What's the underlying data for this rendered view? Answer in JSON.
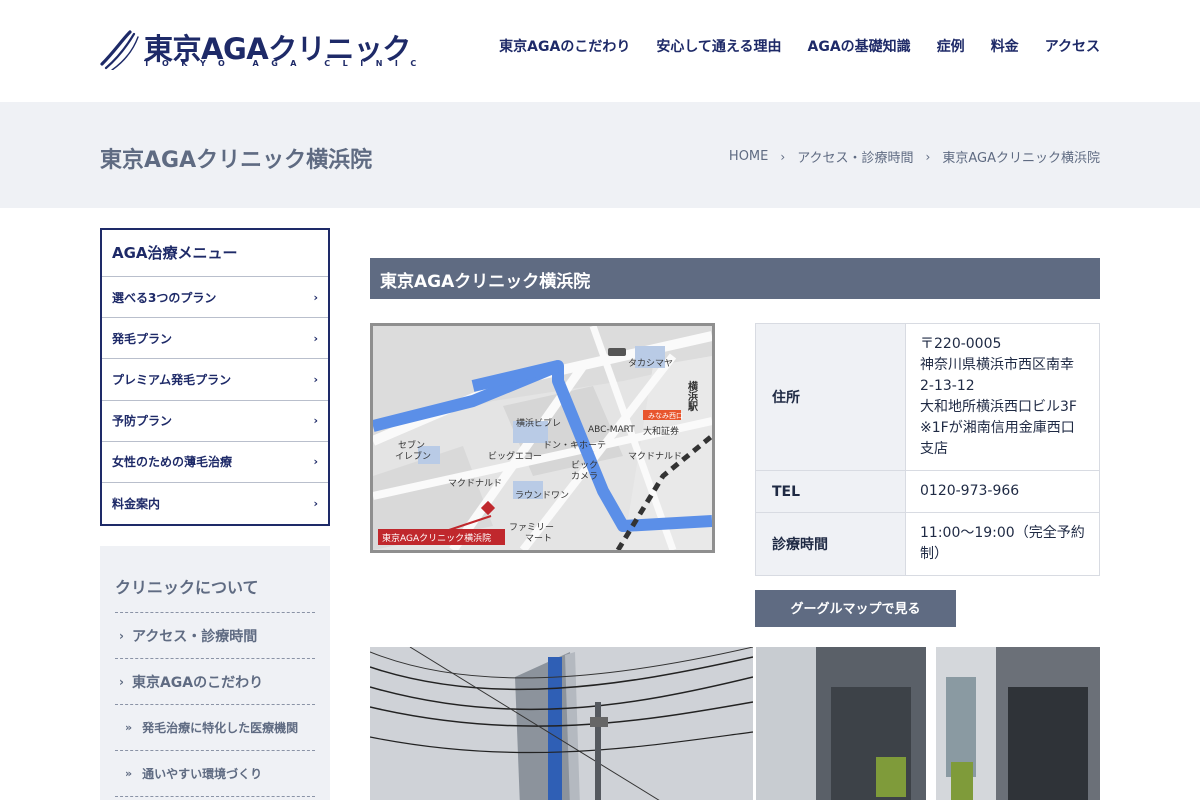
{
  "header": {
    "logo_text": "東京AGAクリニック",
    "logo_sub": "TOKYO AGA CLINIC",
    "nav": [
      "東京AGAのこだわり",
      "安心して通える理由",
      "AGAの基礎知識",
      "症例",
      "料金",
      "アクセス"
    ]
  },
  "title_band": {
    "page_title": "東京AGAクリニック横浜院",
    "breadcrumb": [
      "HOME",
      "アクセス・診療時間",
      "東京AGAクリニック横浜院"
    ]
  },
  "sidebar": {
    "menu_title": "AGA治療メニュー",
    "menu_items": [
      "選べる3つのプラン",
      "発毛プラン",
      "プレミアム発毛プラン",
      "予防プラン",
      "女性のための薄毛治療",
      "料金案内"
    ],
    "about_title": "クリニックについて",
    "about_items": [
      "アクセス・診療時間",
      "東京AGAのこだわり"
    ],
    "about_sub_items": [
      "発毛治療に特化した医療機関",
      "通いやすい環境づくり"
    ]
  },
  "main": {
    "section_title": "東京AGAクリニック横浜院",
    "map_labels": {
      "takashimaya": "タカシマヤ",
      "yokohama_station": "横浜駅",
      "minami_west": "みなみ西口",
      "yokohama_vivre": "横浜ビブレ",
      "abc_mart": "ABC-MART",
      "yamato_securities": "大和証券",
      "don_quijote": "ドン・キホーテ",
      "seven_eleven_1": "セブン",
      "seven_eleven_2": "イレブン",
      "big_echo": "ビッグエコー",
      "bic_camera_1": "ビック",
      "bic_camera_2": "カメラ",
      "mcdonalds_1": "マクドナルド",
      "mcdonalds_2": "マクドナルド",
      "round1": "ラウンドワン",
      "familymart_1": "ファミリー",
      "familymart_2": "マート",
      "clinic": "東京AGAクリニック横浜院"
    },
    "info": {
      "address_label": "住所",
      "address_lines": [
        "〒220-0005",
        "神奈川県横浜市西区南幸",
        "2-13-12",
        "大和地所横浜西口ビル3F",
        "※1Fが湘南信用金庫西口",
        "支店"
      ],
      "tel_label": "TEL",
      "tel": "0120-973-966",
      "hours_label": "診療時間",
      "hours": "11:00〜19:00（完全予約制）"
    },
    "gmap_button": "グーグルマップで見る"
  },
  "colors": {
    "navy": "#1e2a68",
    "slate": "#5f6b82",
    "band": "#eff1f5",
    "map_blue": "#5b8fe8",
    "clinic_red": "#c0282d"
  }
}
